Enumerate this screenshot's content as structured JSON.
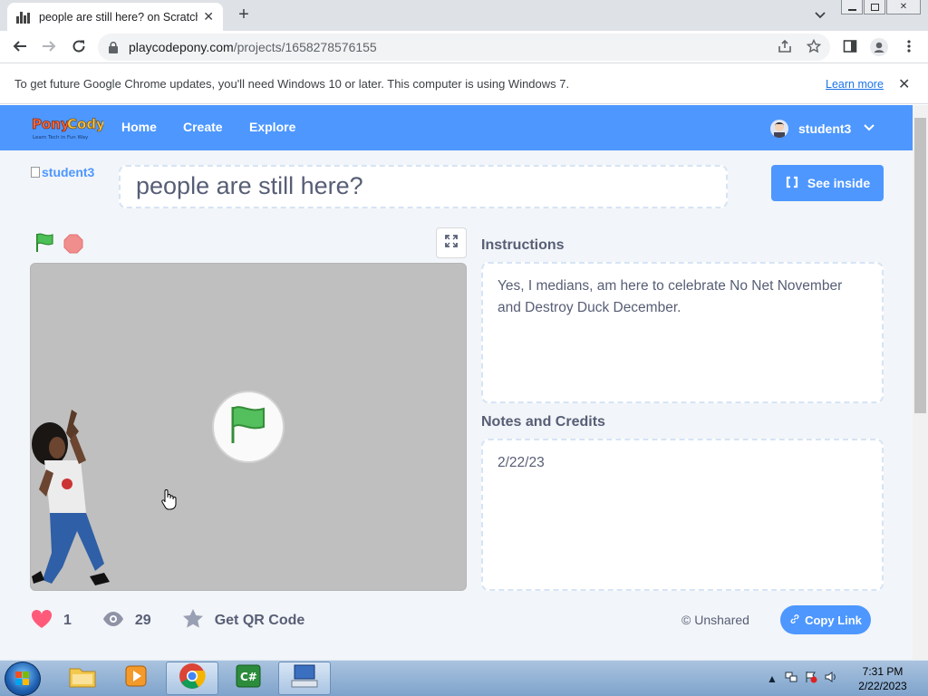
{
  "browser": {
    "tab_title": "people are still here? on Scratch",
    "tab_close": "✕",
    "new_tab": "+",
    "url_host": "playcodepony.com",
    "url_path": "/projects/1658278576155",
    "infobar_text": "To get future Google Chrome updates, you'll need Windows 10 or later. This computer is using Windows 7.",
    "infobar_link": "Learn more",
    "infobar_close": "✕"
  },
  "site": {
    "nav": [
      "Home",
      "Create",
      "Explore"
    ],
    "username": "student3",
    "brand_color": "#4d97ff"
  },
  "project": {
    "author_img_alt": "student3",
    "title": "people are still here?",
    "see_inside": "See inside",
    "instructions_label": "Instructions",
    "instructions": "Yes, I medians, am here to celebrate No Net November and Destroy Duck December.",
    "notes_label": "Notes and Credits",
    "notes": "2/22/23",
    "loves": "1",
    "views": "29",
    "qr_label": "Get QR Code",
    "share_status": "Unshared",
    "copy_link": "Copy Link"
  },
  "taskbar": {
    "time": "7:31 PM",
    "date": "2/22/2023"
  }
}
